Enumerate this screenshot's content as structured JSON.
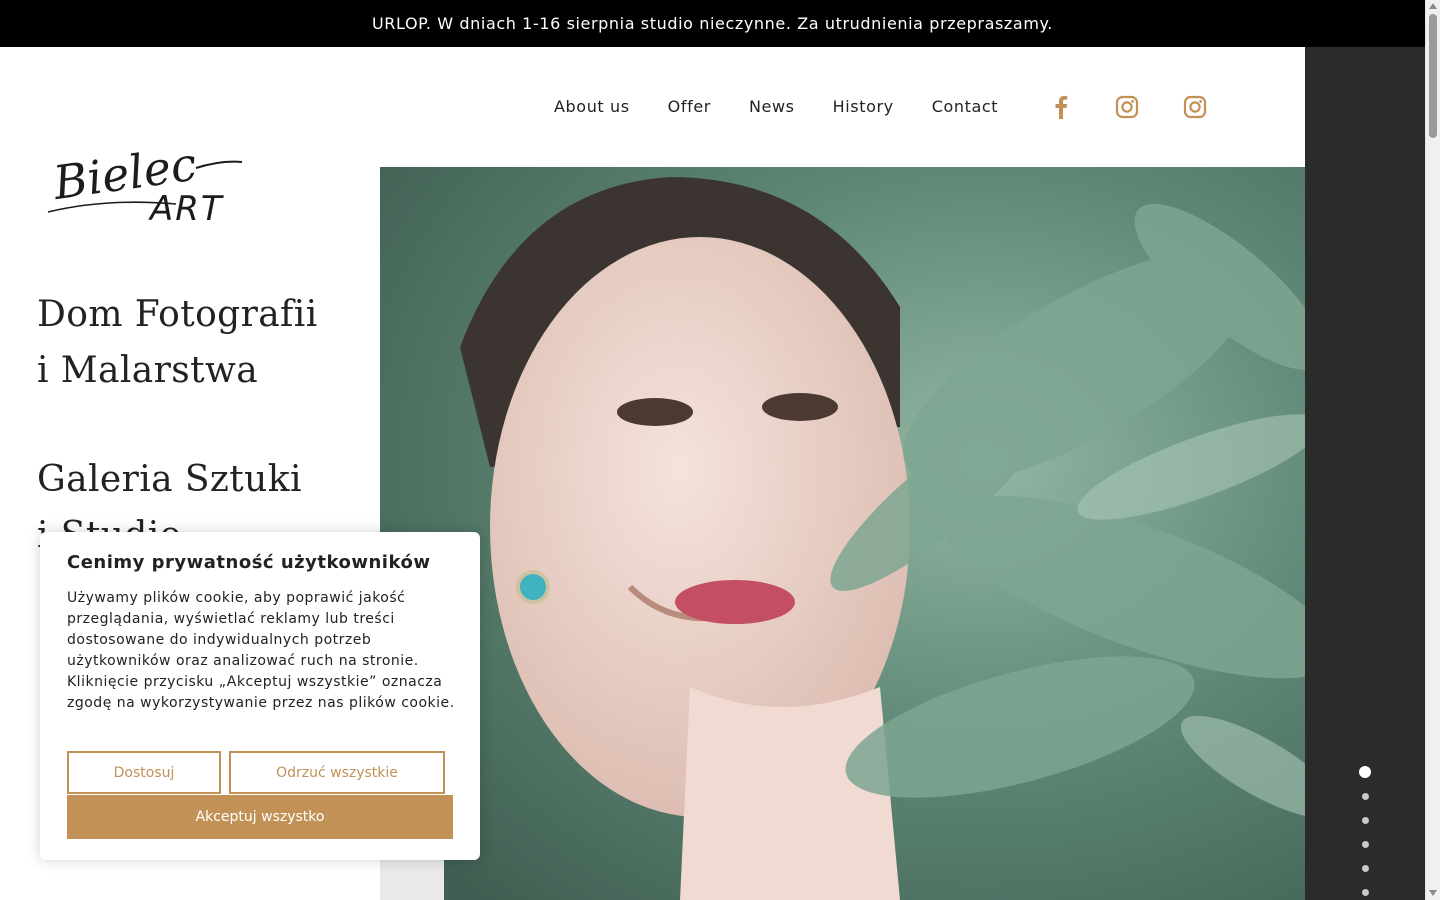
{
  "announcement": "URLOP. W dniach 1-16 sierpnia studio nieczynne. Za utrudnienia przepraszamy.",
  "nav": {
    "items": [
      "About us",
      "Offer",
      "News",
      "History",
      "Contact"
    ],
    "social": [
      "facebook-icon",
      "instagram-icon",
      "instagram-icon"
    ]
  },
  "logo_text": "Bielec ART",
  "headings": {
    "h1_line1": "Dom Fotografii",
    "h1_line2": "i Malarstwa",
    "h2_line1": "Galeria Sztuki",
    "h2_line2": "i Studio"
  },
  "cookie": {
    "title": "Cenimy prywatność użytkowników",
    "text": "Używamy plików cookie, aby poprawić jakość przeglądania, wyświetlać reklamy lub treści dostosowane do indywidualnych potrzeb użytkowników oraz analizować ruch na stronie. Kliknięcie przycisku „Akceptuj wszystkie” oznacza zgodę na wykorzystywanie przez nas plików cookie.",
    "customize": "Dostosuj",
    "reject": "Odrzuć wszystkie",
    "accept": "Akceptuj wszystko"
  },
  "slider": {
    "count": 6,
    "active_index": 0
  },
  "colors": {
    "accent": "#c19155",
    "dark": "#2b2b2c",
    "topbar": "#000000"
  }
}
